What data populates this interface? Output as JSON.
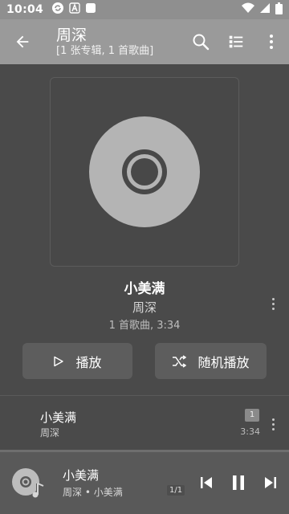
{
  "status_bar": {
    "time": "10:04",
    "icons": [
      "sync-icon",
      "a-icon",
      "square-icon",
      "wifi-icon",
      "signal-icon",
      "battery-icon"
    ]
  },
  "app_bar": {
    "title": "周深",
    "subtitle": "[1 张专辑, 1 首歌曲]",
    "icons": [
      "back-arrow-icon",
      "search-icon",
      "view-list-icon",
      "more-vert-icon"
    ]
  },
  "album": {
    "cover_icon": "disc-icon",
    "title": "小美满",
    "artist": "周深",
    "meta": "1 首歌曲, 3:34"
  },
  "actions": {
    "play_label": "播放",
    "shuffle_label": "随机播放"
  },
  "tracks": [
    {
      "title": "小美满",
      "artist": "周深",
      "number": "1",
      "duration": "3:34"
    }
  ],
  "player": {
    "title": "小美满",
    "subtitle": "周深 • 小美满",
    "queue_position": "1/1",
    "progress": 0.0
  },
  "colors": {
    "app_bar": "#9a9a9a",
    "background": "#4a4a4a",
    "mini_player": "#595959"
  }
}
